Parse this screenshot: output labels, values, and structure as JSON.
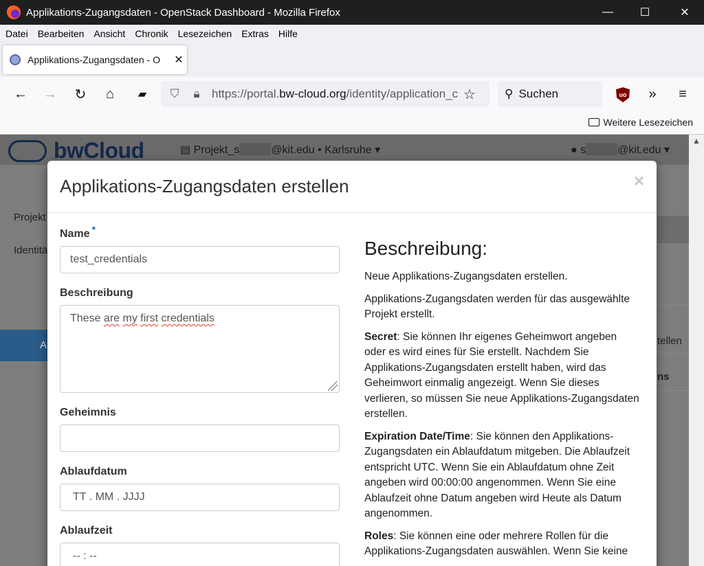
{
  "window": {
    "title": "Applikations-Zugangsdaten - OpenStack Dashboard - Mozilla Firefox",
    "minimize": "—",
    "maximize": "☐",
    "close": "✕"
  },
  "menu": [
    "Datei",
    "Bearbeiten",
    "Ansicht",
    "Chronik",
    "Lesezeichen",
    "Extras",
    "Hilfe"
  ],
  "tab": {
    "label": "Applikations-Zugangsdaten - O",
    "close": "✕"
  },
  "nav": {
    "back": "←",
    "forward": "→",
    "reload": "↻",
    "home": "⌂",
    "url_prefix": "https://portal.",
    "url_host": "bw-cloud.org",
    "url_path": "/identity/application_c",
    "search_placeholder": "Suchen",
    "extensions": "»",
    "menu": "≡",
    "ublock": "uo"
  },
  "bookmarks": {
    "label": "Weitere Lesezeichen"
  },
  "site": {
    "logo": "bwCloud",
    "project_prefix": "Projekt_s",
    "project_suffix": "@kit.edu • Karlsruhe ▾",
    "user_prefix": "s",
    "user_suffix": "@kit.edu ▾",
    "side_projekt": "Projekt",
    "side_identity": "Identitä",
    "bg_a": "A",
    "bg_tellen": "tellen",
    "bg_ns": "ns"
  },
  "modal": {
    "title": "Applikations-Zugangsdaten erstellen",
    "close": "×",
    "fields": {
      "name_label": "Name",
      "name_required": "*",
      "name_value": "test_credentials",
      "desc_label": "Beschreibung",
      "desc_word1": "These",
      "desc_word2": "are",
      "desc_word3": "my",
      "desc_word4": "first",
      "desc_word5": "credentials",
      "secret_label": "Geheimnis",
      "date_label": "Ablaufdatum",
      "date_placeholder": "TT . MM . JJJJ",
      "time_label": "Ablaufzeit",
      "time_placeholder": "-- : --"
    },
    "help": {
      "heading": "Beschreibung:",
      "p1": "Neue Applikations-Zugangsdaten erstellen.",
      "p2": "Applikations-Zugangsdaten werden für das ausgewählte Projekt erstellt.",
      "p3_bold": "Secret",
      "p3": ": Sie können Ihr eigenes Geheimwort angeben oder es wird eines für Sie erstellt. Nachdem Sie Applikations-Zugangsdaten erstellt haben, wird das Geheimwort einmalig angezeigt. Wenn Sie dieses verlieren, so müssen Sie neue Applikations-Zugangsdaten erstellen.",
      "p4_bold": "Expiration Date/Time",
      "p4": ": Sie können den Applikations-Zugangsdaten ein Ablaufdatum mitgeben. Die Ablaufzeit entspricht UTC. Wenn Sie ein Ablaufdatum ohne Zeit angeben wird 00:00:00 angenommen. Wenn Sie eine Ablaufzeit ohne Datum angeben wird Heute als Datum angenommen.",
      "p5_bold": "Roles",
      "p5": ": Sie können eine oder mehrere Rollen für die Applikations-Zugangsdaten auswählen. Wenn Sie keine"
    }
  }
}
